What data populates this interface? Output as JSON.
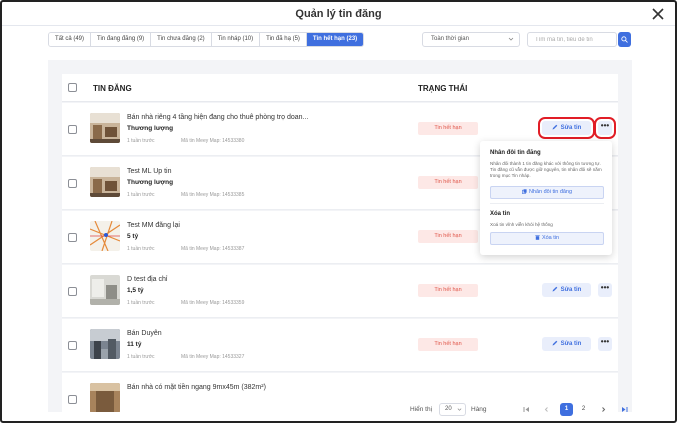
{
  "modal": {
    "title": "Quản lý tin đăng"
  },
  "tabs": [
    {
      "label": "Tất cả (49)",
      "active": false
    },
    {
      "label": "Tin đang đăng (9)",
      "active": false
    },
    {
      "label": "Tin chưa đăng (2)",
      "active": false
    },
    {
      "label": "Tin nháp (10)",
      "active": false
    },
    {
      "label": "Tin đã hạ (5)",
      "active": false
    },
    {
      "label": "Tin hết hạn (23)",
      "active": true
    }
  ],
  "filters": {
    "period": "Toàn thời gian",
    "search_placeholder": "Tìm mã tin, tiêu đề tin"
  },
  "table": {
    "headers": {
      "post": "TIN ĐĂNG",
      "status": "TRẠNG THÁI"
    },
    "rows": [
      {
        "title": "Bán nhà riêng 4 tầng hiện đang cho thuê phòng trọ doan...",
        "price": "Thương lượng",
        "time": "1 tuần trước",
        "code": "Mã tin Meey Map: 14533380",
        "status": "Tin hết hạn",
        "thumb": "interior-photo"
      },
      {
        "title": "Test ML Up tin",
        "price": "Thương lượng",
        "time": "1 tuần trước",
        "code": "Mã tin Meey Map: 14533385",
        "status": "Tin hết hạn",
        "thumb": "interior-photo"
      },
      {
        "title": "Test MM đăng lại",
        "price": "5 tỷ",
        "time": "1 tuần trước",
        "code": "Mã tin Meey Map: 14533387",
        "status": "Tin hết hạn",
        "thumb": "map-photo"
      },
      {
        "title": "D test địa chỉ",
        "price": "1,5 tỷ",
        "time": "1 tuần trước",
        "code": "Mã tin Meey Map: 14533359",
        "status": "Tin hết hạn",
        "thumb": "room-photo"
      },
      {
        "title": "Bán Duyên",
        "price": "11 tỷ",
        "time": "1 tuần trước",
        "code": "Mã tin Meey Map: 14533327",
        "status": "Tin hết hạn",
        "thumb": "street-photo"
      },
      {
        "title": "Bán nhà có mặt tiền ngang 9mx45m (382m²)",
        "price": "",
        "time": "",
        "code": "",
        "status": "",
        "thumb": "house-photo"
      }
    ],
    "edit_label": "Sửa tin",
    "more_label": "•••"
  },
  "popover": {
    "duplicate_heading": "Nhân đôi tin đăng",
    "duplicate_desc": "Nhân đôi thành 1 tin đăng khác với thông tin tương tự. Tin đăng cũ vẫn được giữ nguyên, tin nhân đôi sẽ nằm trong mục Tin nháp.",
    "duplicate_button": "Nhân đôi tin đăng",
    "delete_heading": "Xóa tin",
    "delete_desc": "Xoá tin vĩnh viễn khỏi hệ thống",
    "delete_button": "Xóa tin"
  },
  "footer": {
    "show_label": "Hiển thị",
    "page_size": "20",
    "rows_label": "Hàng",
    "pages": [
      "1",
      "2"
    ],
    "current_page": "1"
  },
  "colors": {
    "accent": "#3f6fdf",
    "status_red": "#e0574b",
    "highlight": "#e11d26"
  }
}
